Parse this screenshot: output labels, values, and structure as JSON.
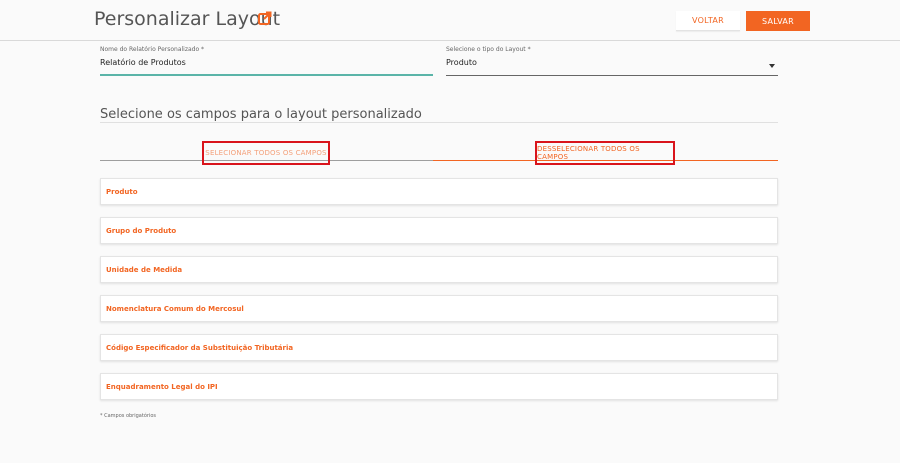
{
  "header": {
    "title": "Personalizar Layout",
    "back_label": "VOLTAR",
    "save_label": "SALVAR",
    "accent_color": "#f26522"
  },
  "form": {
    "report_name_label": "Nome do Relatório Personalizado *",
    "report_name_value": "Relatório de Produtos",
    "layout_type_label": "Selecione o tipo do Layout *",
    "layout_type_value": "Produto"
  },
  "section": {
    "title": "Selecione os campos para o layout personalizado"
  },
  "tabs": {
    "select_all": "SELECIONAR TODOS OS CAMPOS",
    "deselect_all": "DESSELECIONAR TODOS OS CAMPOS"
  },
  "fields": [
    {
      "label": "Produto"
    },
    {
      "label": "Grupo do Produto"
    },
    {
      "label": "Unidade de Medida"
    },
    {
      "label": "Nomenclatura Comum do Mercosul"
    },
    {
      "label": "Código Especificador da Substituição Tributária"
    },
    {
      "label": "Enquadramento Legal do IPI"
    }
  ],
  "footnote": "* Campos obrigatórios"
}
